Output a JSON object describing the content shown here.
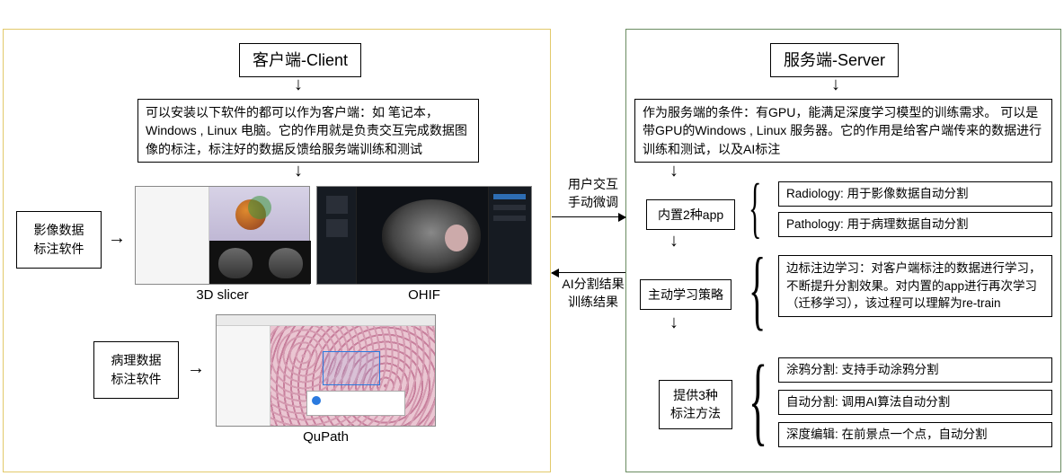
{
  "client": {
    "title": "客户端-Client",
    "desc": "可以安装以下软件的都可以作为客户端：如 笔记本，Windows , Linux 电脑。它的作用就是负责交互完成数据图像的标注，标注好的数据反馈给服务端训练和测试",
    "imgSoft": "影像数据\n标注软件",
    "pathSoft": "病理数据\n标注软件",
    "slicer": "3D slicer",
    "ohif": "OHIF",
    "qupath": "QuPath"
  },
  "exchange": {
    "toServer": "用户交互\n手动微调",
    "toClient": "AI分割结果\n训练结果"
  },
  "server": {
    "title": "服务端-Server",
    "desc": "作为服务端的条件：有GPU，能满足深度学习模型的训练需求。 可以是带GPU的Windows , Linux 服务器。它的作用是给客户端传来的数据进行训练和测试，以及AI标注",
    "apps": {
      "label": "内置2种app",
      "radiology": "Radiology: 用于影像数据自动分割",
      "pathology": "Pathology: 用于病理数据自动分割"
    },
    "active": {
      "label": "主动学习策略",
      "desc": "边标注边学习：对客户端标注的数据进行学习，不断提升分割效果。对内置的app进行再次学习（迁移学习），该过程可以理解为re-train"
    },
    "methods": {
      "label": "提供3种\n标注方法",
      "scribble": "涂鸦分割: 支持手动涂鸦分割",
      "auto": "自动分割: 调用AI算法自动分割",
      "deepedit": "深度编辑: 在前景点一个点，自动分割"
    }
  }
}
